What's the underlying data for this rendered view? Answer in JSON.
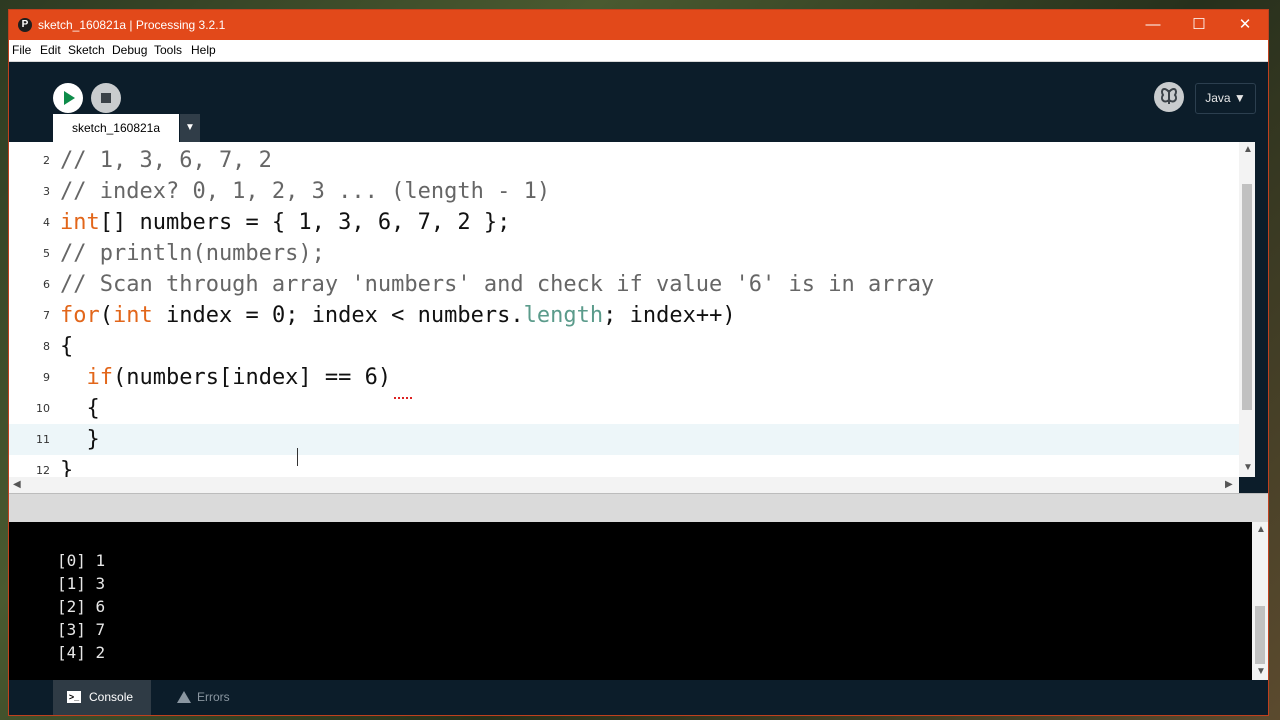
{
  "window": {
    "title": "sketch_160821a | Processing 3.2.1",
    "controls": {
      "minimize": "—",
      "maximize": "☐",
      "close": "✕"
    }
  },
  "menu": [
    "File",
    "Edit",
    "Sketch",
    "Debug",
    "Tools",
    "Help"
  ],
  "toolbar": {
    "mode_label": "Java ▼"
  },
  "editor": {
    "tab_label": "sketch_160821a",
    "lines": [
      {
        "n": "2",
        "code": "// 1, 3, 6, 7, 2"
      },
      {
        "n": "3",
        "code": "// index? 0, 1, 2, 3 ... (length - 1)"
      },
      {
        "n": "4",
        "code": "int[] numbers = { 1, 3, 6, 7, 2 };"
      },
      {
        "n": "5",
        "code": "// println(numbers);"
      },
      {
        "n": "6",
        "code": "// Scan through array 'numbers' and check if value '6' is in array"
      },
      {
        "n": "7",
        "code": "for(int index = 0; index < numbers.length; index++)"
      },
      {
        "n": "8",
        "code": "{"
      },
      {
        "n": "9",
        "code": "  if(numbers[index] == 6)"
      },
      {
        "n": "10",
        "code": "  {"
      },
      {
        "n": "11",
        "code": "  }"
      },
      {
        "n": "12",
        "code": "}"
      }
    ]
  },
  "console": {
    "lines": [
      "[0] 1",
      "[1] 3",
      "[2] 6",
      "[3] 7",
      "[4] 2"
    ]
  },
  "footer": {
    "console_tab": "Console",
    "errors_tab": "Errors"
  },
  "colors": {
    "titlebar": "#e2491a",
    "chrome": "#0c1d2a",
    "keyword": "#e2661a",
    "comment": "#666666"
  }
}
